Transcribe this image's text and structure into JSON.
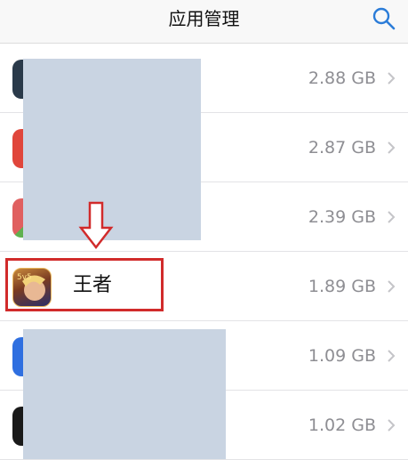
{
  "header": {
    "back_text": "",
    "title": "应用管理",
    "search_icon": "search-icon"
  },
  "apps": [
    {
      "name": "",
      "size": "2.88 GB",
      "icon_color": "#2a3a4a"
    },
    {
      "name": "",
      "size": "2.87 GB",
      "icon_color": "#e0463b"
    },
    {
      "name": "",
      "size": "2.39 GB",
      "icon_color": "#5fb14f"
    },
    {
      "name": "王者",
      "size": "1.89 GB",
      "icon_color": "#7a3b22"
    },
    {
      "name": "",
      "size": "1.09 GB",
      "icon_color": "#2f6fe0"
    },
    {
      "name": "",
      "size": "1.02 GB",
      "icon_color": "#1a1a1a"
    }
  ],
  "colors": {
    "accent": "#2b7cd8",
    "highlight": "#d12b2b",
    "cover": "#c9d4e2"
  },
  "annotation": {
    "arrow_icon": "down-arrow-icon"
  }
}
